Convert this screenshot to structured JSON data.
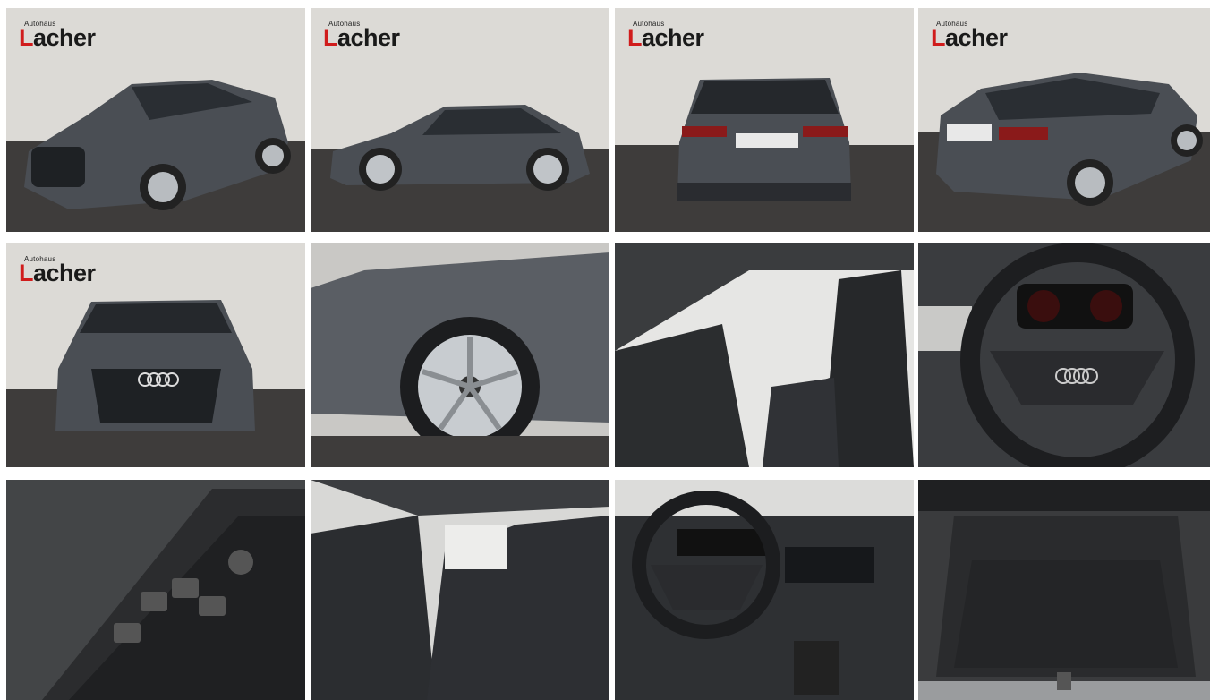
{
  "gallery": {
    "logo": {
      "small": "Autohaus",
      "main": "Lacher"
    },
    "photos": [
      {
        "name": "photo-front-left-exterior",
        "logo": true
      },
      {
        "name": "photo-side-exterior",
        "logo": true
      },
      {
        "name": "photo-rear-exterior",
        "logo": true
      },
      {
        "name": "photo-rear-right-exterior",
        "logo": true
      },
      {
        "name": "photo-front-exterior",
        "logo": true
      },
      {
        "name": "photo-wheel-closeup",
        "logo": false
      },
      {
        "name": "photo-front-seats-interior",
        "logo": false
      },
      {
        "name": "photo-steering-wheel",
        "logo": false
      },
      {
        "name": "photo-door-controls",
        "logo": false
      },
      {
        "name": "photo-rear-seats",
        "logo": false
      },
      {
        "name": "photo-dashboard",
        "logo": false
      },
      {
        "name": "photo-trunk",
        "logo": false
      }
    ]
  },
  "colors": {
    "logo_accent": "#d01c1c",
    "car_grey": "#4a4e54",
    "wall": "#dcdad6",
    "floor": "#3e3c3b"
  }
}
